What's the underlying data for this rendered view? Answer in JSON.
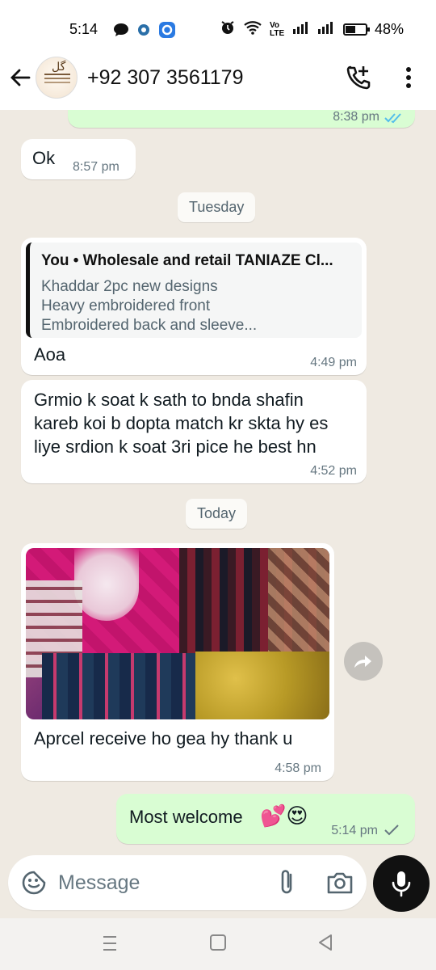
{
  "status_bar": {
    "time": "5:14",
    "battery": "48%",
    "volte_label": "Vo LTE"
  },
  "header": {
    "contact_name": "+92 307 3561179",
    "back_icon": "arrow-left-icon",
    "call_icon": "add-call-icon",
    "menu_icon": "more-vertical-icon"
  },
  "messages": [
    {
      "id": "m0",
      "direction": "out",
      "text": "",
      "time": "8:38 pm",
      "status": "read"
    },
    {
      "id": "m1",
      "direction": "in",
      "text": "Ok",
      "time": "8:57 pm"
    },
    {
      "id": "d1",
      "type": "date",
      "text": "Tuesday"
    },
    {
      "id": "m2",
      "direction": "in",
      "quote": {
        "title": "You • Wholesale and retail TANIAZE Cl...",
        "lines": [
          "Khaddar 2pc new designs",
          "Heavy embroidered front",
          "Embroidered back and sleeve..."
        ]
      },
      "text": "Aoa",
      "time": "4:49 pm"
    },
    {
      "id": "m3",
      "direction": "in",
      "lines": [
        "Grmio k soat k sath to bnda shafin",
        "kareb koi b dopta match kr skta hy es",
        "liye srdion k soat 3ri pice he best hn"
      ],
      "time": "4:52 pm"
    },
    {
      "id": "d2",
      "type": "date",
      "text": "Today"
    },
    {
      "id": "m4",
      "direction": "in",
      "has_image": true,
      "text": "Aprcel receive ho gea hy thank u",
      "time": "4:58 pm"
    },
    {
      "id": "m5",
      "direction": "out",
      "text": "Most welcome",
      "emoji": "💕😍",
      "time": "5:14 pm",
      "status": "sent"
    }
  ],
  "input": {
    "placeholder": "Message",
    "value": ""
  },
  "colors": {
    "chat_bg": "#efeae2",
    "incoming": "#ffffff",
    "outgoing": "#d9fdd3",
    "read_tick": "#53bdeb"
  }
}
